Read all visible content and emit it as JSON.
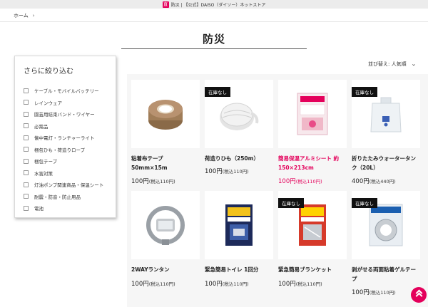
{
  "browser": {
    "favicon_text": "直",
    "tab_title": "防災 | 【公式】DAISO（ダイソー）ネットストア"
  },
  "breadcrumb": {
    "home": "ホーム",
    "separator": "›"
  },
  "page": {
    "title": "防災"
  },
  "filter": {
    "heading": "さらに絞り込む",
    "items": [
      "ケーブル・モバイルバッテリー",
      "レインウェア",
      "園芸用結束バンド・ワイヤー",
      "必需品",
      "懐中電灯・ランチャーライト",
      "梱包ひも・荷造りロープ",
      "梱包テープ",
      "水害対策",
      "灯油ポンプ関連商品・保温シート",
      "耐震・防音・防止用品",
      "電池"
    ]
  },
  "sort": {
    "label": "並び替え: 人気順",
    "chevron": "⌄"
  },
  "colors": {
    "brand_pink": "#e4005b",
    "badge_black": "#111111",
    "card_bg": "#f6f6f6"
  },
  "products": [
    {
      "name": "粘着布テープ 50mm×15m",
      "price": "100円",
      "tax": "(税込110円)",
      "badge": "",
      "highlight": false,
      "icon": "tape-roll-image"
    },
    {
      "name": "荷造りひも（250m）",
      "price": "100円",
      "tax": "(税込110円)",
      "badge": "在庫なし",
      "highlight": false,
      "icon": "string-roll-image"
    },
    {
      "name": "簡易保温アルミシート 約150×213cm",
      "price": "100円",
      "tax": "(税込110円)",
      "badge": "",
      "highlight": true,
      "icon": "thermal-sheet-image"
    },
    {
      "name": "折りたたみウォータータンク（20L）",
      "price": "400円",
      "tax": "(税込440円)",
      "badge": "在庫なし",
      "highlight": false,
      "icon": "water-tank-image"
    },
    {
      "name": "2WAYランタン",
      "price": "100円",
      "tax": "(税込110円)",
      "badge": "",
      "highlight": false,
      "icon": "lantern-image"
    },
    {
      "name": "緊急簡易トイレ 1回分",
      "price": "100円",
      "tax": "(税込110円)",
      "badge": "",
      "highlight": false,
      "icon": "toilet-kit-image"
    },
    {
      "name": "緊急簡易ブランケット",
      "price": "100円",
      "tax": "(税込110円)",
      "badge": "在庫なし",
      "highlight": false,
      "icon": "blanket-image"
    },
    {
      "name": "剥がせる両面粘着ゲルテープ",
      "price": "100円",
      "tax": "(税込110円)",
      "badge": "在庫なし",
      "highlight": false,
      "icon": "gel-tape-image"
    }
  ]
}
